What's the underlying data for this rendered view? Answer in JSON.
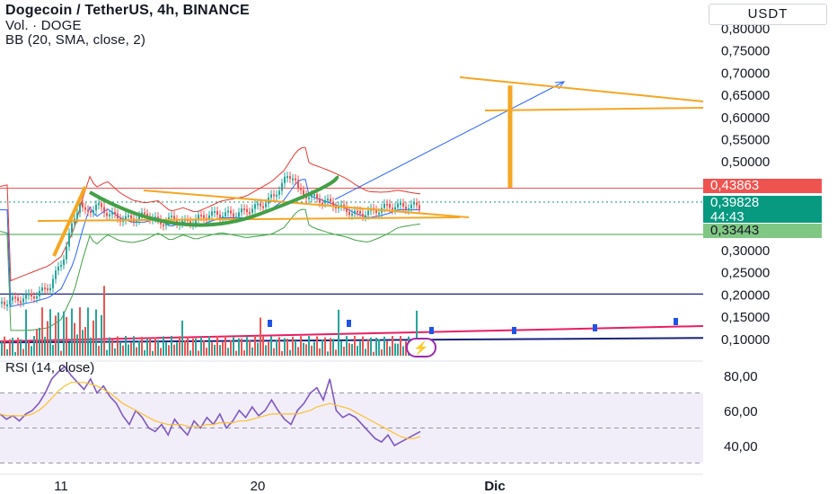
{
  "header": {
    "title": "Dogecoin / TetherUS, 4h, BINANCE",
    "volume_label": "Vol. · DOGE",
    "bb_label": "BB (20, SMA, close, 2)",
    "currency": "USDT"
  },
  "rsi_panel": {
    "label": "RSI (14, close)"
  },
  "price_tags": {
    "resistance": {
      "value": "0,43863",
      "color": "#ef5350"
    },
    "last": {
      "value": "0,39828",
      "countdown": "44:43",
      "color": "#089981"
    },
    "support": {
      "value": "0,33443",
      "color": "#81c784"
    }
  },
  "colors": {
    "up": "#26a69a",
    "down": "#ef5350",
    "bb_upper": "#e53935",
    "bb_basis": "#2962ff",
    "bb_lower": "#43a047",
    "drawing": "#f5a623",
    "pattern": "#43a047",
    "rsi": "#7e57c2",
    "rsi_ma": "#fbc02d",
    "hline_blue": "#1a237e",
    "volume_up": "#26a69a",
    "volume_down": "#ef5350",
    "volume_line": "#e91e63"
  },
  "chart_data": [
    {
      "type": "line",
      "title": "Dogecoin / TetherUS, 4h, BINANCE",
      "x_ticks": [
        "11",
        "20",
        "Dic"
      ],
      "y_ticks": [
        "0,80000",
        "0,75000",
        "0,70000",
        "0,65000",
        "0,60000",
        "0,55000",
        "0,50000",
        "0,45000",
        "0,40000",
        "0,35000",
        "0,30000",
        "0,25000",
        "0,20000",
        "0,15000",
        "0,10000"
      ],
      "ylim": [
        0.09,
        0.82
      ],
      "horizontal_levels": [
        0.43863,
        0.33443,
        0.2,
        0.095
      ],
      "last_price": 0.39828,
      "price_path": [
        {
          "x": 0,
          "y": 0.18
        },
        {
          "x": 0.05,
          "y": 0.19
        },
        {
          "x": 0.09,
          "y": 0.2
        },
        {
          "x": 0.12,
          "y": 0.22
        },
        {
          "x": 0.15,
          "y": 0.28
        },
        {
          "x": 0.17,
          "y": 0.35
        },
        {
          "x": 0.19,
          "y": 0.41
        },
        {
          "x": 0.2,
          "y": 0.38
        },
        {
          "x": 0.23,
          "y": 0.4
        },
        {
          "x": 0.26,
          "y": 0.38
        },
        {
          "x": 0.29,
          "y": 0.37
        },
        {
          "x": 0.32,
          "y": 0.37
        },
        {
          "x": 0.35,
          "y": 0.38
        },
        {
          "x": 0.38,
          "y": 0.36
        },
        {
          "x": 0.41,
          "y": 0.37
        },
        {
          "x": 0.44,
          "y": 0.36
        },
        {
          "x": 0.47,
          "y": 0.37
        },
        {
          "x": 0.5,
          "y": 0.38
        },
        {
          "x": 0.53,
          "y": 0.38
        },
        {
          "x": 0.56,
          "y": 0.38
        },
        {
          "x": 0.59,
          "y": 0.39
        },
        {
          "x": 0.62,
          "y": 0.4
        },
        {
          "x": 0.65,
          "y": 0.42
        },
        {
          "x": 0.68,
          "y": 0.46
        },
        {
          "x": 0.7,
          "y": 0.47
        },
        {
          "x": 0.71,
          "y": 0.43
        },
        {
          "x": 0.74,
          "y": 0.42
        },
        {
          "x": 0.77,
          "y": 0.41
        },
        {
          "x": 0.8,
          "y": 0.4
        },
        {
          "x": 0.82,
          "y": 0.39
        },
        {
          "x": 0.85,
          "y": 0.38
        },
        {
          "x": 0.88,
          "y": 0.385
        },
        {
          "x": 0.9,
          "y": 0.39
        },
        {
          "x": 0.92,
          "y": 0.398
        }
      ],
      "projection": {
        "from_y": 0.4,
        "to_y": 0.685,
        "measured_move_top": 0.67,
        "measured_move_bottom": 0.44
      }
    },
    {
      "type": "line",
      "title": "RSI (14, close)",
      "y_ticks": [
        "80,00",
        "60,00",
        "40,00"
      ],
      "ylim": [
        20,
        95
      ],
      "band": [
        30,
        70
      ],
      "rsi": [
        58,
        55,
        57,
        54,
        58,
        60,
        64,
        70,
        78,
        82,
        85,
        80,
        76,
        72,
        78,
        70,
        74,
        68,
        64,
        57,
        52,
        60,
        56,
        50,
        48,
        52,
        46,
        55,
        50,
        46,
        54,
        50,
        56,
        52,
        58,
        50,
        54,
        60,
        56,
        62,
        57,
        60,
        66,
        60,
        55,
        52,
        60,
        64,
        70,
        73,
        66,
        78,
        60,
        56,
        58,
        56,
        52,
        48,
        44,
        42,
        46,
        40,
        42,
        44,
        46,
        48
      ],
      "rsi_ma": [
        58,
        57,
        57,
        57,
        57,
        58,
        60,
        63,
        67,
        71,
        74,
        76,
        76,
        76,
        75,
        74,
        72,
        70,
        67,
        64,
        62,
        60,
        58,
        56,
        54,
        53,
        52,
        52,
        52,
        51,
        51,
        51,
        52,
        52,
        53,
        53,
        53,
        54,
        54,
        55,
        56,
        57,
        58,
        58,
        58,
        58,
        58,
        59,
        60,
        62,
        63,
        64,
        63,
        62,
        61,
        59,
        57,
        55,
        53,
        51,
        49,
        47,
        45,
        44,
        44,
        45
      ]
    }
  ]
}
